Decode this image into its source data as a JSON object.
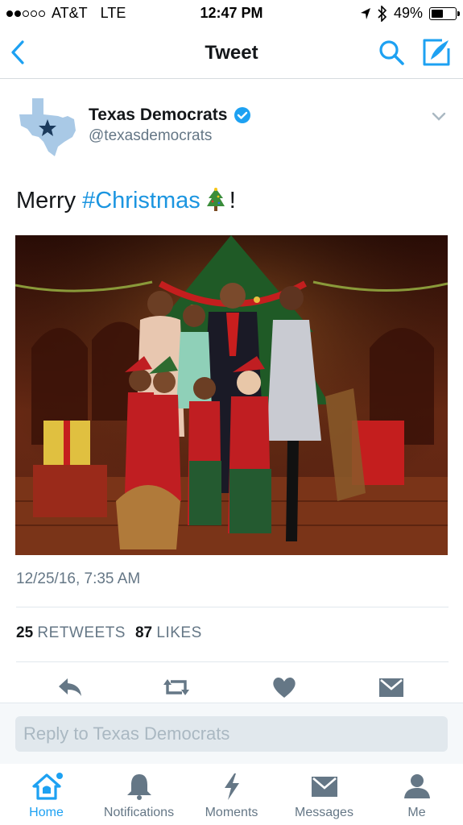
{
  "status_bar": {
    "carrier": "AT&T",
    "network": "LTE",
    "time": "12:47 PM",
    "battery_text": "49%",
    "battery_level": 0.49,
    "signal_dots_filled": 2,
    "signal_dots_total": 5
  },
  "nav": {
    "title": "Tweet",
    "back_icon": "chevron-left-icon",
    "search_icon": "search-icon",
    "compose_icon": "compose-icon"
  },
  "tweet": {
    "author_name": "Texas Democrats",
    "author_handle": "@texasdemocrats",
    "verified": true,
    "text_prefix": "Merry",
    "hashtag": "#Christmas",
    "emoji": "christmas-tree",
    "text_suffix": "!",
    "timestamp": "12/25/16, 7:35 AM",
    "retweets_count": "25",
    "retweets_label": "RETWEETS",
    "likes_count": "87",
    "likes_label": "LIKES"
  },
  "reply": {
    "placeholder": "Reply to Texas Democrats"
  },
  "tabs": [
    {
      "label": "Home",
      "icon": "home-icon",
      "active": true
    },
    {
      "label": "Notifications",
      "icon": "bell-icon",
      "active": false
    },
    {
      "label": "Moments",
      "icon": "lightning-icon",
      "active": false
    },
    {
      "label": "Messages",
      "icon": "envelope-icon",
      "active": false
    },
    {
      "label": "Me",
      "icon": "person-icon",
      "active": false
    }
  ],
  "colors": {
    "accent": "#1da1f2",
    "hashtag": "#1b95e0",
    "secondary_text": "#657786",
    "action_icon": "#657786"
  }
}
